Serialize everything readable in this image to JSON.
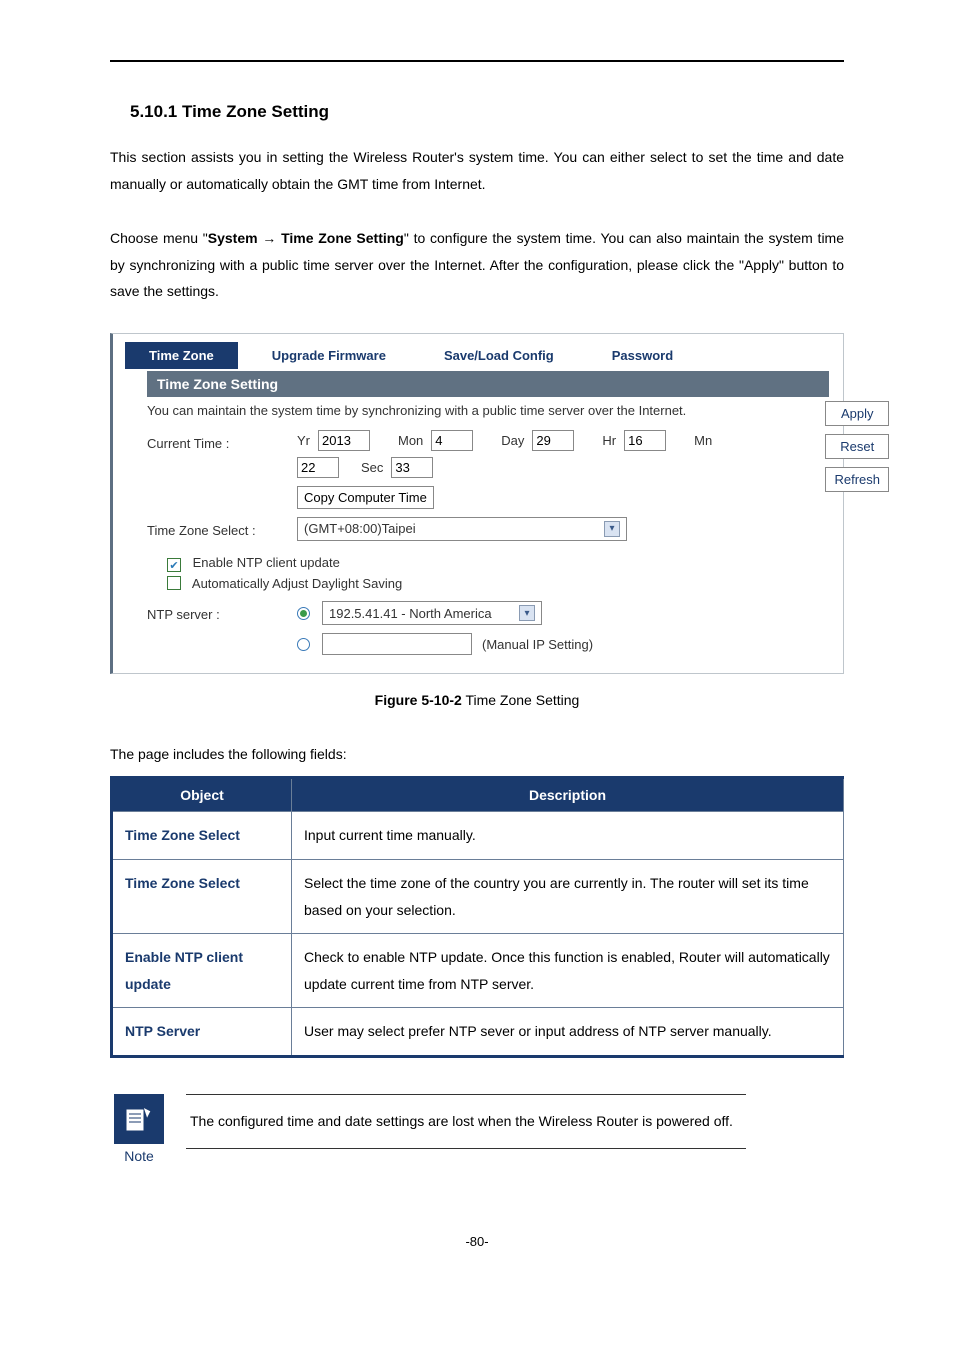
{
  "headings": {
    "section": "5.10.1 Time Zone Setting"
  },
  "paragraphs": {
    "intro1": "This section assists you in setting the Wireless Router's system time. You can either select to set the time and date manually or automatically obtain the GMT time from Internet.",
    "intro2_pre": "Choose menu \"",
    "intro2_bold1": "System",
    "intro2_arrow": " → ",
    "intro2_bold2": "Time Zone Setting",
    "intro2_post": "\" to configure the system time. You can also maintain the system time by synchronizing with a public time server over the Internet. After the configuration, please click the \"Apply\" button to save the settings.",
    "fields_intro": "The page includes the following fields:",
    "note": "The configured time and date settings are lost when the Wireless Router is powered off."
  },
  "screenshot": {
    "tabs": {
      "timezone": "Time Zone",
      "upgrade": "Upgrade Firmware",
      "saveload": "Save/Load Config",
      "password": "Password"
    },
    "panel_title": "Time Zone Setting",
    "panel_desc": "You can maintain the system time by synchronizing with a public time server over the Internet.",
    "buttons": {
      "apply": "Apply",
      "reset": "Reset",
      "refresh": "Refresh",
      "copy": "Copy Computer Time"
    },
    "labels": {
      "current_time": "Current Time :",
      "yr": "Yr",
      "mon": "Mon",
      "day": "Day",
      "hr": "Hr",
      "mn": "Mn",
      "sec": "Sec",
      "tz_select": "Time Zone Select :",
      "enable_ntp": "Enable NTP client update",
      "auto_dst": "Automatically Adjust Daylight Saving",
      "ntp_server": "NTP server :",
      "manual": "(Manual IP Setting)"
    },
    "values": {
      "yr": "2013",
      "mon": "4",
      "day": "29",
      "hr": "16",
      "mn": "22",
      "sec": "33",
      "tz": "(GMT+08:00)Taipei",
      "ntp": "192.5.41.41 - North America"
    },
    "checks": {
      "ntp": true,
      "dst": false,
      "radio_preset": true,
      "radio_manual": false
    }
  },
  "figure": {
    "bold": "Figure 5-10-2",
    "rest": " Time Zone Setting"
  },
  "table": {
    "headers": {
      "object": "Object",
      "description": "Description"
    },
    "rows": [
      {
        "obj": "Time Zone Select",
        "desc": "Input current time manually."
      },
      {
        "obj": "Time Zone Select",
        "desc": "Select the time zone of the country you are currently in. The router will set its time based on your selection."
      },
      {
        "obj": "Enable NTP client update",
        "desc": "Check to enable NTP update. Once this function is enabled, Router will automatically update current time from NTP server."
      },
      {
        "obj": "NTP Server",
        "desc": "User may select prefer NTP sever or input address of NTP server manually."
      }
    ]
  },
  "note_label": "Note",
  "page_number": "-80-"
}
